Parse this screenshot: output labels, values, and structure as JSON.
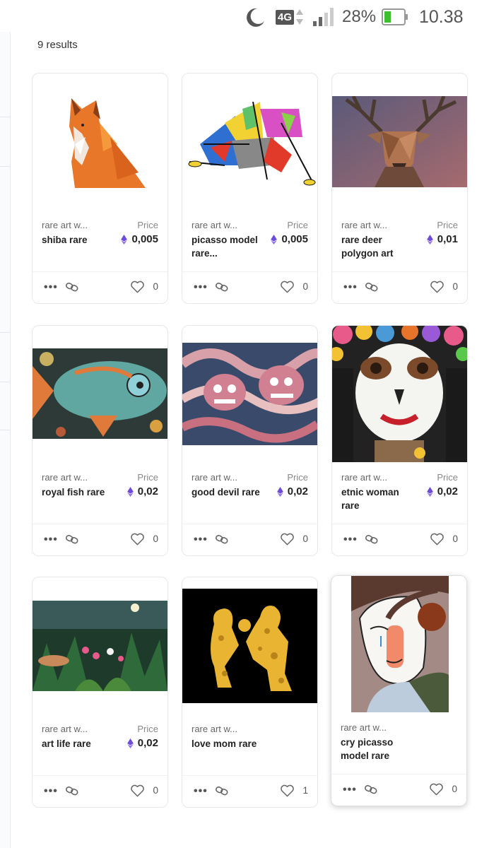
{
  "status_bar": {
    "network": "4G",
    "battery": "28%",
    "time": "10.38"
  },
  "results_count": "9 results",
  "items": [
    {
      "collection": "rare art w...",
      "price_label": "Price",
      "name": "shiba rare",
      "price": "0,005",
      "likes": "0"
    },
    {
      "collection": "rare art w...",
      "price_label": "Price",
      "name": "picasso model rare...",
      "price": "0,005",
      "likes": "0"
    },
    {
      "collection": "rare art w...",
      "price_label": "Price",
      "name": "rare deer polygon art",
      "price": "0,01",
      "likes": "0"
    },
    {
      "collection": "rare art w...",
      "price_label": "Price",
      "name": "royal fish rare",
      "price": "0,02",
      "likes": "0"
    },
    {
      "collection": "rare art w...",
      "price_label": "Price",
      "name": "good devil rare",
      "price": "0,02",
      "likes": "0"
    },
    {
      "collection": "rare art w...",
      "price_label": "Price",
      "name": "etnic woman rare",
      "price": "0,02",
      "likes": "0"
    },
    {
      "collection": "rare art w...",
      "price_label": "Price",
      "name": "art life rare",
      "price": "0,02",
      "likes": "0"
    },
    {
      "collection": "rare art w...",
      "price_label": "",
      "name": "love mom rare",
      "price": "",
      "likes": "1"
    },
    {
      "collection": "rare art w...",
      "price_label": "",
      "name": "cry picasso model rare",
      "price": "",
      "likes": "0"
    }
  ],
  "colors": {
    "eth": "#6e4bd8",
    "battery": "#3fbf2f"
  },
  "icons": {
    "more": "more-dots-icon",
    "link": "link-icon",
    "like": "heart-icon",
    "currency": "ethereum-icon"
  }
}
